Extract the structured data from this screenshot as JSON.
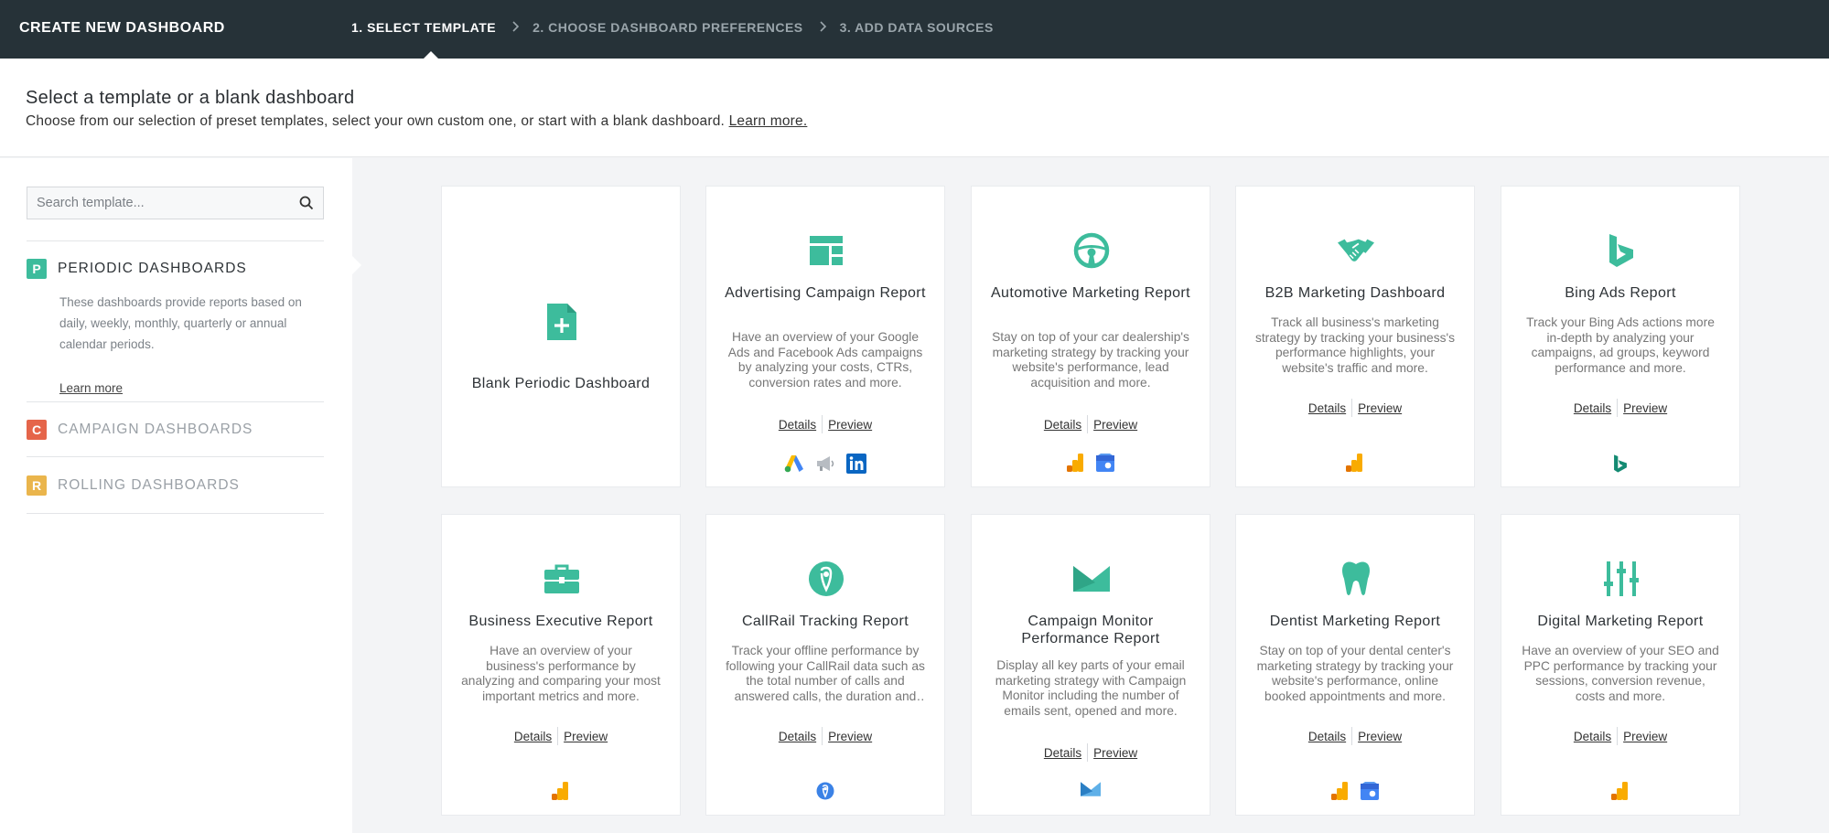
{
  "topbar": {
    "title": "CREATE NEW DASHBOARD",
    "steps": [
      "1. SELECT TEMPLATE",
      "2. CHOOSE DASHBOARD PREFERENCES",
      "3. ADD DATA SOURCES"
    ]
  },
  "header": {
    "title": "Select a template or a blank dashboard",
    "subtitle": "Choose from our selection of preset templates, select your own custom one, or start with a blank dashboard.",
    "learn_more": "Learn more."
  },
  "sidebar": {
    "search_placeholder": "Search template...",
    "categories": [
      {
        "letter": "P",
        "label": "PERIODIC DASHBOARDS",
        "color": "#3dbc9c",
        "active": true,
        "description": "These dashboards provide reports based on daily, weekly, monthly, quarterly or annual calendar periods.",
        "learn_more": "Learn more"
      },
      {
        "letter": "C",
        "label": "CAMPAIGN DASHBOARDS",
        "color": "#e5654a"
      },
      {
        "letter": "R",
        "label": "ROLLING DASHBOARDS",
        "color": "#eab54c"
      }
    ]
  },
  "colors": {
    "accent": "#3dbc9c",
    "topbar": "#263238"
  },
  "cards": [
    {
      "title": "Blank Periodic Dashboard",
      "icon": "blank-file-icon"
    },
    {
      "title": "Advertising Campaign Report",
      "icon": "layout-icon",
      "description": "Have an overview of your Google Ads and Facebook Ads campaigns by analyzing your costs, CTRs, conversion rates and more.",
      "details": "Details",
      "preview": "Preview",
      "sources": [
        "google-ads-icon",
        "megaphone-icon",
        "linkedin-icon"
      ]
    },
    {
      "title": "Automotive Marketing Report",
      "icon": "steering-wheel-icon",
      "description": "Stay on top of your car dealership's marketing strategy by tracking your website's performance, lead acquisition and more.",
      "details": "Details",
      "preview": "Preview",
      "sources": [
        "google-analytics-icon",
        "google-my-business-icon"
      ]
    },
    {
      "title": "B2B Marketing Dashboard",
      "icon": "handshake-icon",
      "description": "Track all business's marketing strategy by tracking your business's performance highlights, your website's traffic and more.",
      "details": "Details",
      "preview": "Preview",
      "sources": [
        "google-analytics-icon"
      ]
    },
    {
      "title": "Bing Ads Report",
      "icon": "bing-icon",
      "description": "Track your Bing Ads actions more in-depth by analyzing your campaigns, ad groups, keyword performance and more.",
      "details": "Details",
      "preview": "Preview",
      "sources": [
        "bing-icon"
      ]
    },
    {
      "title": "Business Executive Report",
      "icon": "briefcase-icon",
      "description": "Have an overview of your business's performance by analyzing and comparing your most important metrics and more.",
      "details": "Details",
      "preview": "Preview",
      "sources": [
        "google-analytics-icon"
      ]
    },
    {
      "title": "CallRail Tracking Report",
      "icon": "callrail-icon",
      "description": "Track your offline performance by following your CallRail data such as the total number of calls and answered calls, the duration and more.",
      "details": "Details",
      "preview": "Preview",
      "sources": [
        "callrail-icon"
      ]
    },
    {
      "title": "Campaign Monitor Performance Report",
      "icon": "envelope-icon",
      "description": "Display all key parts of your email marketing strategy with Campaign Monitor including the number of emails sent, opened and more.",
      "details": "Details",
      "preview": "Preview",
      "sources": [
        "campaign-monitor-icon"
      ]
    },
    {
      "title": "Dentist Marketing Report",
      "icon": "tooth-icon",
      "description": "Stay on top of your dental center's marketing strategy by tracking your website's performance, online booked appointments and more.",
      "details": "Details",
      "preview": "Preview",
      "sources": [
        "google-analytics-icon",
        "google-my-business-icon"
      ]
    },
    {
      "title": "Digital Marketing Report",
      "icon": "sliders-icon",
      "description": "Have an overview of your SEO and PPC performance by tracking your sessions, conversion revenue, costs and more.",
      "details": "Details",
      "preview": "Preview",
      "sources": [
        "google-analytics-icon"
      ]
    }
  ]
}
